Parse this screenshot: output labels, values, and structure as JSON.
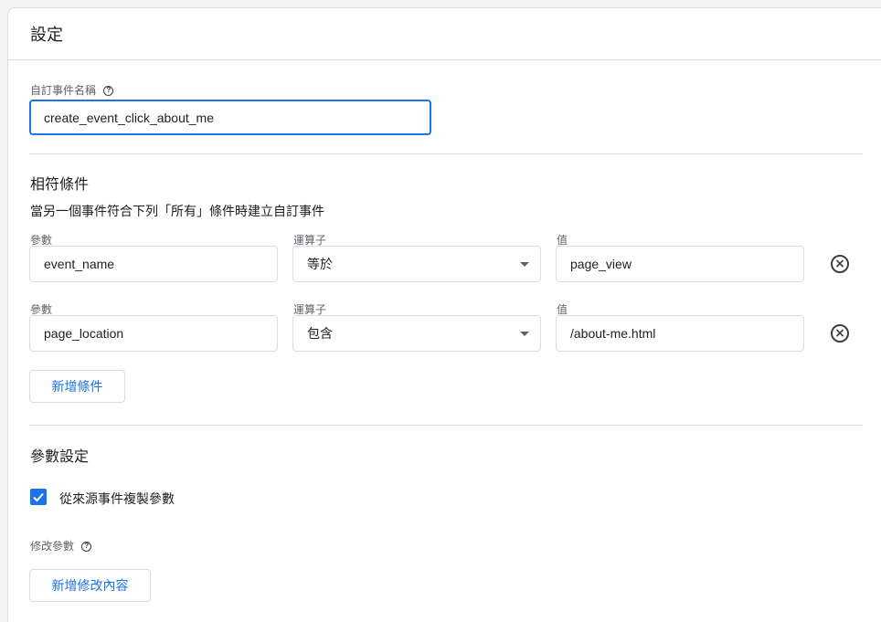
{
  "card": {
    "title": "設定"
  },
  "event_name": {
    "label": "自訂事件名稱",
    "help_icon": "help-circle-icon",
    "value": "create_event_click_about_me"
  },
  "conditions": {
    "title": "相符條件",
    "description": "當另一個事件符合下列「所有」條件時建立自訂事件",
    "rows": [
      {
        "param_label": "參數",
        "param_value": "event_name",
        "operator_label": "運算子",
        "operator_value": "等於",
        "value_label": "值",
        "value": "page_view",
        "remove_icon": "remove-circle-icon"
      },
      {
        "param_label": "參數",
        "param_value": "page_location",
        "operator_label": "運算子",
        "operator_value": "包含",
        "value_label": "值",
        "value": "/about-me.html",
        "remove_icon": "remove-circle-icon"
      }
    ],
    "add_button": "新增條件"
  },
  "param_settings": {
    "title": "參數設定",
    "copy_checkbox_label": "從來源事件複製參數",
    "copy_checked": true,
    "modify_label": "修改參數",
    "add_modify_button": "新增修改內容"
  },
  "colors": {
    "accent": "#1a73e8",
    "border": "#dadce0",
    "text": "#202124",
    "muted": "#5f6368"
  }
}
